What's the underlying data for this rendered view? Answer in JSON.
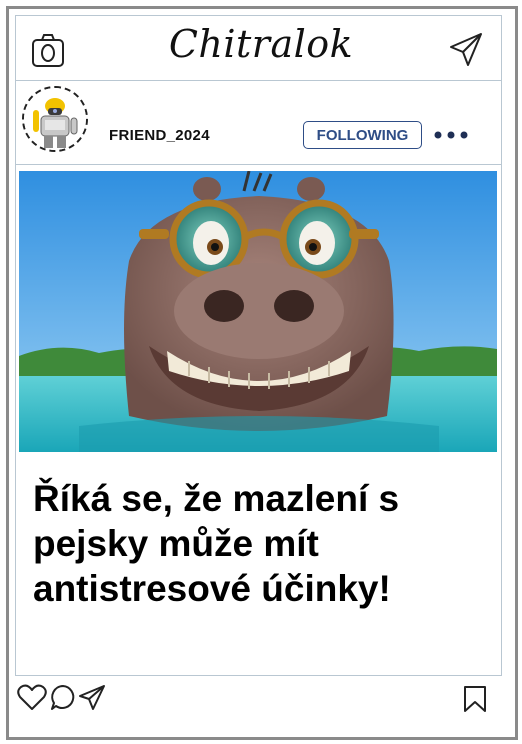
{
  "app": {
    "brand": "Chitralok"
  },
  "post": {
    "username": "FRIEND_2024",
    "follow_label": "FOLLOWING",
    "caption": "Říká se, že mazlení s pejsky může mít antistresové účinky!"
  },
  "icons": {
    "top_left": "camera-icon",
    "top_right": "send-icon",
    "more": "more-dots-icon",
    "actions": [
      "heart-icon",
      "comment-icon",
      "share-icon",
      "bookmark-icon"
    ]
  },
  "colors": {
    "follow_accent": "#2e4d86",
    "frame": "#8a8a8a",
    "divider": "#b9c7d2"
  }
}
